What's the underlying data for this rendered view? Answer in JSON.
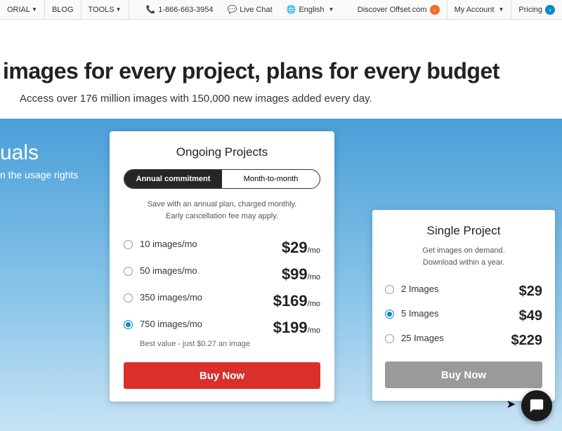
{
  "topbar": {
    "nav": [
      "ORIAL",
      "BLOG",
      "TOOLS"
    ],
    "phone": "1-866-663-3954",
    "live_chat": "Live Chat",
    "language": "English",
    "discover": "Discover Offset.com",
    "account": "My Account",
    "pricing": "Pricing"
  },
  "hero": {
    "headline": "images for every project, plans for every budget",
    "sub": "Access over 176 million images with 150,000 new images added every day."
  },
  "left": {
    "t1": "uals",
    "t2": "n the usage rights"
  },
  "ongoing": {
    "title": "Ongoing Projects",
    "tab_annual": "Annual commitment",
    "tab_monthly": "Month-to-month",
    "fine1": "Save with an annual plan, charged monthly.",
    "fine2": "Early cancellation fee may apply.",
    "plans": [
      {
        "label": "10 images/mo",
        "price": "$29",
        "per": "/mo"
      },
      {
        "label": "50 images/mo",
        "price": "$99",
        "per": "/mo"
      },
      {
        "label": "350 images/mo",
        "price": "$169",
        "per": "/mo"
      },
      {
        "label": "750 images/mo",
        "price": "$199",
        "per": "/mo"
      }
    ],
    "best": "Best value - just $0.27 an image",
    "buy": "Buy Now"
  },
  "single": {
    "title": "Single Project",
    "fine1": "Get images on demand.",
    "fine2": "Download within a year.",
    "plans": [
      {
        "label": "2 Images",
        "price": "$29"
      },
      {
        "label": "5 Images",
        "price": "$49"
      },
      {
        "label": "25 Images",
        "price": "$229"
      }
    ],
    "buy": "Buy Now"
  }
}
